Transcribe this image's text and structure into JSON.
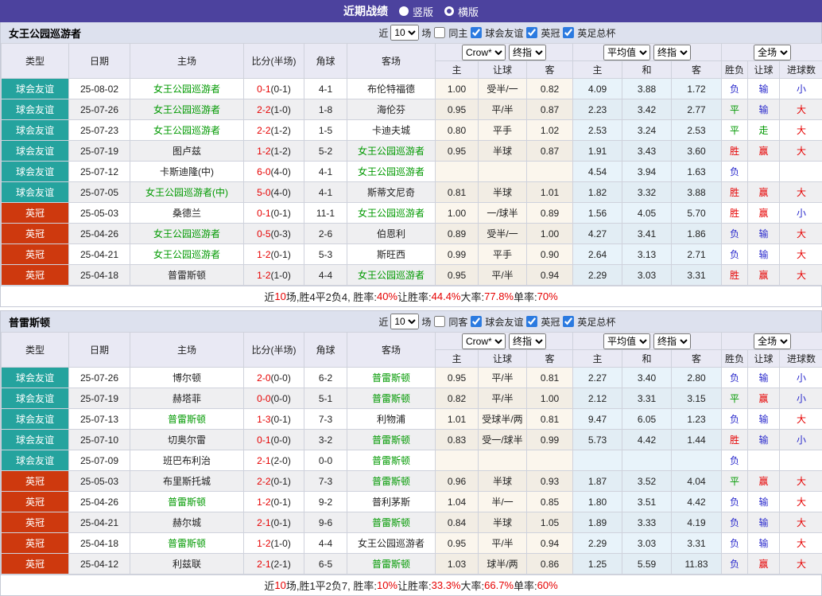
{
  "titlebar": {
    "title": "近期战绩",
    "radio_vertical": "竖版",
    "radio_horizontal": "横版"
  },
  "colors": {
    "header_purple": "#4c429e",
    "friendly_badge": "#25a39e",
    "league_badge": "#ce390e",
    "team_green": "#009900",
    "score_red": "#e60000",
    "win_red": "#e60000",
    "draw_green": "#009900",
    "lose_blue": "#2929cc"
  },
  "type_colors": {
    "球会友谊": "#25a39e",
    "英冠": "#ce390e"
  },
  "result_colors": {
    "胜": "#e60000",
    "平": "#009900",
    "负": "#2929cc",
    "赢": "#e60000",
    "走": "#009900",
    "输": "#2929cc",
    "大": "#e60000",
    "小": "#2929cc"
  },
  "sections": [
    {
      "team": "女王公园巡游者",
      "filter": {
        "prefix": "近",
        "count": "10",
        "suffix": "场",
        "venue_label": "同主",
        "league_labels": [
          "球会友谊",
          "英冠",
          "英足总杯"
        ]
      },
      "columns": {
        "type": "类型",
        "date": "日期",
        "home": "主场",
        "score": "比分(半场)",
        "corner": "角球",
        "away": "客场",
        "crow_company": "Crow*",
        "crow_final": "终指",
        "avg_company": "平均值",
        "avg_final": "终指",
        "scope": "全场",
        "sub": [
          "主",
          "让球",
          "客",
          "主",
          "和",
          "客",
          "胜负",
          "让球",
          "进球数"
        ]
      },
      "rows": [
        {
          "t": "球会友谊",
          "d": "25-08-02",
          "h": "女王公园巡游者",
          "hg": true,
          "s": "0-1",
          "sh": "(0-1)",
          "c": "4-1",
          "a": "布伦特福德",
          "ag": false,
          "o1": "1.00",
          "hc": "受半/一",
          "o2": "0.82",
          "m1": "4.09",
          "m2": "3.88",
          "m3": "1.72",
          "r1": "负",
          "r2": "输",
          "r3": "小"
        },
        {
          "t": "球会友谊",
          "d": "25-07-26",
          "h": "女王公园巡游者",
          "hg": true,
          "s": "2-2",
          "sh": "(1-0)",
          "c": "1-8",
          "a": "海伦芬",
          "ag": false,
          "o1": "0.95",
          "hc": "平/半",
          "o2": "0.87",
          "m1": "2.23",
          "m2": "3.42",
          "m3": "2.77",
          "r1": "平",
          "r2": "输",
          "r3": "大"
        },
        {
          "t": "球会友谊",
          "d": "25-07-23",
          "h": "女王公园巡游者",
          "hg": true,
          "s": "2-2",
          "sh": "(1-2)",
          "c": "1-5",
          "a": "卡迪夫城",
          "ag": false,
          "o1": "0.80",
          "hc": "平手",
          "o2": "1.02",
          "m1": "2.53",
          "m2": "3.24",
          "m3": "2.53",
          "r1": "平",
          "r2": "走",
          "r3": "大"
        },
        {
          "t": "球会友谊",
          "d": "25-07-19",
          "h": "图卢兹",
          "hg": false,
          "s": "1-2",
          "sh": "(1-2)",
          "c": "5-2",
          "a": "女王公园巡游者",
          "ag": true,
          "o1": "0.95",
          "hc": "半球",
          "o2": "0.87",
          "m1": "1.91",
          "m2": "3.43",
          "m3": "3.60",
          "r1": "胜",
          "r2": "赢",
          "r3": "大"
        },
        {
          "t": "球会友谊",
          "d": "25-07-12",
          "h": "卡斯迪隆(中)",
          "hg": false,
          "s": "6-0",
          "sh": "(4-0)",
          "c": "4-1",
          "a": "女王公园巡游者",
          "ag": true,
          "o1": "",
          "hc": "",
          "o2": "",
          "m1": "4.54",
          "m2": "3.94",
          "m3": "1.63",
          "r1": "负",
          "r2": "",
          "r3": ""
        },
        {
          "t": "球会友谊",
          "d": "25-07-05",
          "h": "女王公园巡游者(中)",
          "hg": true,
          "s": "5-0",
          "sh": "(4-0)",
          "c": "4-1",
          "a": "斯蒂文尼奇",
          "ag": false,
          "o1": "0.81",
          "hc": "半球",
          "o2": "1.01",
          "m1": "1.82",
          "m2": "3.32",
          "m3": "3.88",
          "r1": "胜",
          "r2": "赢",
          "r3": "大"
        },
        {
          "t": "英冠",
          "d": "25-05-03",
          "h": "桑德兰",
          "hg": false,
          "s": "0-1",
          "sh": "(0-1)",
          "c": "11-1",
          "a": "女王公园巡游者",
          "ag": true,
          "o1": "1.00",
          "hc": "一/球半",
          "o2": "0.89",
          "m1": "1.56",
          "m2": "4.05",
          "m3": "5.70",
          "r1": "胜",
          "r2": "赢",
          "r3": "小"
        },
        {
          "t": "英冠",
          "d": "25-04-26",
          "h": "女王公园巡游者",
          "hg": true,
          "s": "0-5",
          "sh": "(0-3)",
          "c": "2-6",
          "a": "伯恩利",
          "ag": false,
          "o1": "0.89",
          "hc": "受半/一",
          "o2": "1.00",
          "m1": "4.27",
          "m2": "3.41",
          "m3": "1.86",
          "r1": "负",
          "r2": "输",
          "r3": "大"
        },
        {
          "t": "英冠",
          "d": "25-04-21",
          "h": "女王公园巡游者",
          "hg": true,
          "s": "1-2",
          "sh": "(0-1)",
          "c": "5-3",
          "a": "斯旺西",
          "ag": false,
          "o1": "0.99",
          "hc": "平手",
          "o2": "0.90",
          "m1": "2.64",
          "m2": "3.13",
          "m3": "2.71",
          "r1": "负",
          "r2": "输",
          "r3": "大"
        },
        {
          "t": "英冠",
          "d": "25-04-18",
          "h": "普雷斯顿",
          "hg": false,
          "s": "1-2",
          "sh": "(1-0)",
          "c": "4-4",
          "a": "女王公园巡游者",
          "ag": true,
          "o1": "0.95",
          "hc": "平/半",
          "o2": "0.94",
          "m1": "2.29",
          "m2": "3.03",
          "m3": "3.31",
          "r1": "胜",
          "r2": "赢",
          "r3": "大"
        }
      ],
      "summary": [
        [
          "近",
          0
        ],
        [
          "10",
          1
        ],
        [
          "场,胜4平2负4, 胜率:",
          0
        ],
        [
          "40%",
          1
        ],
        [
          " 让胜率:",
          0
        ],
        [
          "44.4%",
          1
        ],
        [
          " 大率:",
          0
        ],
        [
          "77.8%",
          1
        ],
        [
          " 单率:",
          0
        ],
        [
          "70%",
          1
        ]
      ]
    },
    {
      "team": "普雷斯顿",
      "filter": {
        "prefix": "近",
        "count": "10",
        "suffix": "场",
        "venue_label": "同客",
        "league_labels": [
          "球会友谊",
          "英冠",
          "英足总杯"
        ]
      },
      "columns": {
        "type": "类型",
        "date": "日期",
        "home": "主场",
        "score": "比分(半场)",
        "corner": "角球",
        "away": "客场",
        "crow_company": "Crow*",
        "crow_final": "终指",
        "avg_company": "平均值",
        "avg_final": "终指",
        "scope": "全场",
        "sub": [
          "主",
          "让球",
          "客",
          "主",
          "和",
          "客",
          "胜负",
          "让球",
          "进球数"
        ]
      },
      "rows": [
        {
          "t": "球会友谊",
          "d": "25-07-26",
          "h": "博尔顿",
          "hg": false,
          "s": "2-0",
          "sh": "(0-0)",
          "c": "6-2",
          "a": "普雷斯顿",
          "ag": true,
          "o1": "0.95",
          "hc": "平/半",
          "o2": "0.81",
          "m1": "2.27",
          "m2": "3.40",
          "m3": "2.80",
          "r1": "负",
          "r2": "输",
          "r3": "小"
        },
        {
          "t": "球会友谊",
          "d": "25-07-19",
          "h": "赫塔菲",
          "hg": false,
          "s": "0-0",
          "sh": "(0-0)",
          "c": "5-1",
          "a": "普雷斯顿",
          "ag": true,
          "o1": "0.82",
          "hc": "平/半",
          "o2": "1.00",
          "m1": "2.12",
          "m2": "3.31",
          "m3": "3.15",
          "r1": "平",
          "r2": "赢",
          "r3": "小"
        },
        {
          "t": "球会友谊",
          "d": "25-07-13",
          "h": "普雷斯顿",
          "hg": true,
          "s": "1-3",
          "sh": "(0-1)",
          "c": "7-3",
          "a": "利物浦",
          "ag": false,
          "o1": "1.01",
          "hc": "受球半/两",
          "o2": "0.81",
          "m1": "9.47",
          "m2": "6.05",
          "m3": "1.23",
          "r1": "负",
          "r2": "输",
          "r3": "大"
        },
        {
          "t": "球会友谊",
          "d": "25-07-10",
          "h": "切奥尔雷",
          "hg": false,
          "s": "0-1",
          "sh": "(0-0)",
          "c": "3-2",
          "a": "普雷斯顿",
          "ag": true,
          "o1": "0.83",
          "hc": "受一/球半",
          "o2": "0.99",
          "m1": "5.73",
          "m2": "4.42",
          "m3": "1.44",
          "r1": "胜",
          "r2": "输",
          "r3": "小"
        },
        {
          "t": "球会友谊",
          "d": "25-07-09",
          "h": "班巴布利治",
          "hg": false,
          "s": "2-1",
          "sh": "(2-0)",
          "c": "0-0",
          "a": "普雷斯顿",
          "ag": true,
          "o1": "",
          "hc": "",
          "o2": "",
          "m1": "",
          "m2": "",
          "m3": "",
          "r1": "负",
          "r2": "",
          "r3": ""
        },
        {
          "t": "英冠",
          "d": "25-05-03",
          "h": "布里斯托城",
          "hg": false,
          "s": "2-2",
          "sh": "(0-1)",
          "c": "7-3",
          "a": "普雷斯顿",
          "ag": true,
          "o1": "0.96",
          "hc": "半球",
          "o2": "0.93",
          "m1": "1.87",
          "m2": "3.52",
          "m3": "4.04",
          "r1": "平",
          "r2": "赢",
          "r3": "大"
        },
        {
          "t": "英冠",
          "d": "25-04-26",
          "h": "普雷斯顿",
          "hg": true,
          "s": "1-2",
          "sh": "(0-1)",
          "c": "9-2",
          "a": "普利茅斯",
          "ag": false,
          "o1": "1.04",
          "hc": "半/一",
          "o2": "0.85",
          "m1": "1.80",
          "m2": "3.51",
          "m3": "4.42",
          "r1": "负",
          "r2": "输",
          "r3": "大"
        },
        {
          "t": "英冠",
          "d": "25-04-21",
          "h": "赫尔城",
          "hg": false,
          "s": "2-1",
          "sh": "(0-1)",
          "c": "9-6",
          "a": "普雷斯顿",
          "ag": true,
          "o1": "0.84",
          "hc": "半球",
          "o2": "1.05",
          "m1": "1.89",
          "m2": "3.33",
          "m3": "4.19",
          "r1": "负",
          "r2": "输",
          "r3": "大"
        },
        {
          "t": "英冠",
          "d": "25-04-18",
          "h": "普雷斯顿",
          "hg": true,
          "s": "1-2",
          "sh": "(1-0)",
          "c": "4-4",
          "a": "女王公园巡游者",
          "ag": false,
          "o1": "0.95",
          "hc": "平/半",
          "o2": "0.94",
          "m1": "2.29",
          "m2": "3.03",
          "m3": "3.31",
          "r1": "负",
          "r2": "输",
          "r3": "大"
        },
        {
          "t": "英冠",
          "d": "25-04-12",
          "h": "利兹联",
          "hg": false,
          "s": "2-1",
          "sh": "(2-1)",
          "c": "6-5",
          "a": "普雷斯顿",
          "ag": true,
          "o1": "1.03",
          "hc": "球半/两",
          "o2": "0.86",
          "m1": "1.25",
          "m2": "5.59",
          "m3": "11.83",
          "r1": "负",
          "r2": "赢",
          "r3": "大"
        }
      ],
      "summary": [
        [
          "近",
          0
        ],
        [
          "10",
          1
        ],
        [
          "场,胜1平2负7, 胜率:",
          0
        ],
        [
          "10%",
          1
        ],
        [
          " 让胜率:",
          0
        ],
        [
          "33.3%",
          1
        ],
        [
          " 大率:",
          0
        ],
        [
          "66.7%",
          1
        ],
        [
          " 单率:",
          0
        ],
        [
          "60%",
          1
        ]
      ]
    }
  ]
}
